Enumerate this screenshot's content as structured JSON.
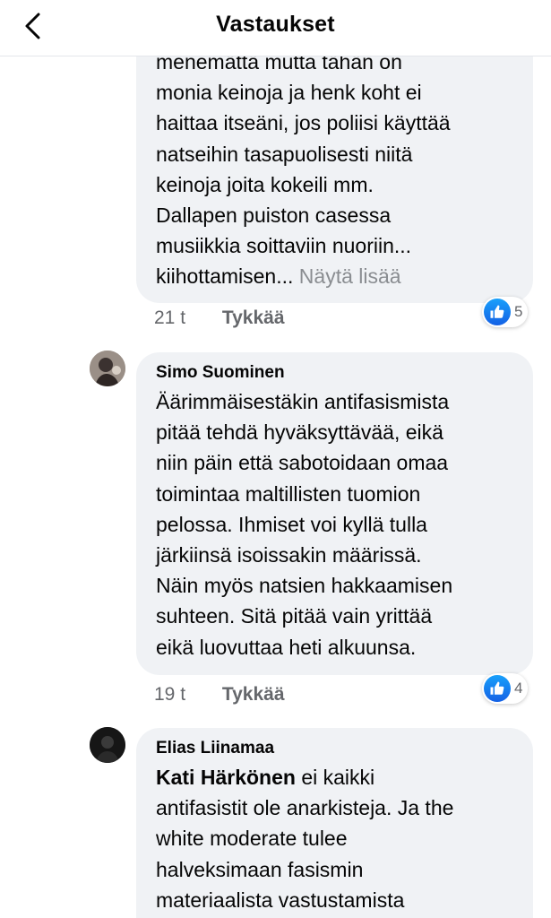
{
  "header": {
    "title": "Vastaukset"
  },
  "comments": [
    {
      "text_lines": [
        "menemättä mutta tähän on",
        "monia keinoja ja henk koht ei",
        "haittaa itseäni, jos poliisi käyttää",
        "natseihin tasapuolisesti niitä",
        "keinoja joita kokeili mm.",
        "Dallapen puiston casessa",
        "musiikkia soittaviin nuoriin..."
      ],
      "last_line": "kiihottamisen...",
      "see_more": "Näytä lisää",
      "time": "21 t",
      "like_label": "Tykkää",
      "reactions": "5"
    },
    {
      "author": "Simo Suominen",
      "text_lines": [
        "Äärimmäisestäkin antifasismista",
        "pitää tehdä hyväksyttävää, eikä",
        "niin päin että sabotoidaan omaa",
        "toimintaa maltillisten tuomion",
        "pelossa. Ihmiset voi kyllä tulla",
        "järkiinsä isoissakin määrissä.",
        "Näin myös natsien hakkaamisen",
        "suhteen. Sitä pitää vain yrittää",
        "eikä luovuttaa heti alkuunsa."
      ],
      "time": "19 t",
      "like_label": "Tykkää",
      "reactions": "4"
    },
    {
      "author": "Elias Liinamaa",
      "mention": "Kati Härkönen",
      "first_line_rest": " ei kaikki",
      "text_lines": [
        "antifasistit ole anarkisteja. Ja the",
        "white moderate tulee",
        "halveksimaan fasismin",
        "materiaalista vastustamista"
      ]
    }
  ],
  "colors": {
    "bubble": "#f0f2f5",
    "like_blue": "#1877f2",
    "muted": "#65676b"
  },
  "icons": {
    "back": "chevron-left-icon",
    "reaction": "like-thumb-icon"
  }
}
